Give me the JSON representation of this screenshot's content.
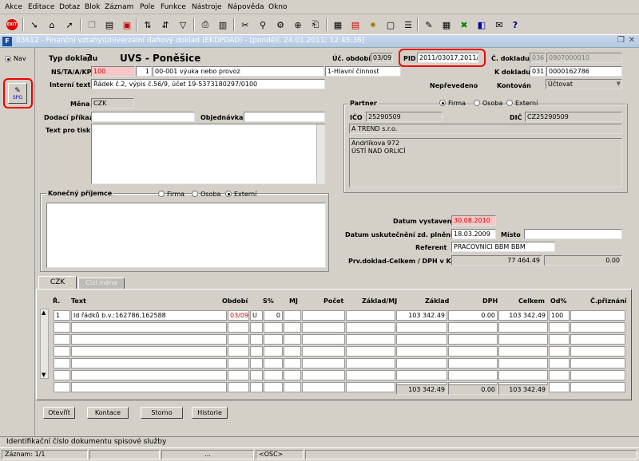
{
  "menu": [
    "Akce",
    "Editace",
    "Dotaz",
    "Blok",
    "Záznam",
    "Pole",
    "Funkce",
    "Nástroje",
    "Nápověda",
    "Okno"
  ],
  "window_title": "03612 - Finanční vztahy\\Univerzální daňový doklad (EKDPDAD) - [pondělí, 24.01.2011; 12:45:36]",
  "left": {
    "nav": "Nav",
    "spg": "SPG"
  },
  "header": {
    "typ_label": "Typ dokladu",
    "typ_value": "7",
    "typ_name": "UVS - Poněšice",
    "uc_obdobi_label": "Úč. období",
    "uc_obdobi": "03/09",
    "pid_label": "PID",
    "pid": "2011/03017,2011/0",
    "c_dokladu_label": "Č. dokladu",
    "c_dokladu_a": "036",
    "c_dokladu_b": "0907000010",
    "ns_label": "NS/TA/A/KP",
    "ns": "100",
    "ta": "1",
    "a": "00-001 výuka nebo provoz",
    "kp": "1-Hlavní činnost",
    "k_dokladu_label": "K dokladu",
    "k_dokladu_a": "031",
    "k_dokladu_b": "0000162786",
    "interni_label": "Interní text",
    "interni": "Řádek č.2,  výpis č.56/9, účet 19-5373180297/0100",
    "neprevedeno": "Nepřevedeno",
    "kontovan_label": "Kontován",
    "kontovan": "Účtovat"
  },
  "form": {
    "mena_label": "Měna",
    "mena": "CZK",
    "dodaci_label": "Dodací příkaz",
    "objednavka_label": "Objednávka",
    "text_tisk_label": "Text pro tisk",
    "konecny_label": "Konečný příjemce",
    "r_firma": "Firma",
    "r_osoba": "Osoba",
    "r_externi": "Externí"
  },
  "partner": {
    "label": "Partner",
    "r_firma": "Firma",
    "r_osoba": "Osoba",
    "r_externi": "Externí",
    "ico_label": "IČO",
    "ico": "25290509",
    "dic_label": "DIČ",
    "dic": "CZ25290509",
    "name": "A TREND s.r.o.",
    "addr1": "Andrlíkova 972",
    "addr2": "ÚSTÍ NAD ORLICÍ"
  },
  "dates": {
    "vystaveni_label": "Datum vystavení",
    "vystaveni": "30.08.2010",
    "zd_label": "Datum uskutečnění zd. plnění",
    "zd": "18.03.2009",
    "misto_label": "Místo",
    "referent_label": "Referent",
    "referent": "PRACOVNÍCI BBM BBM",
    "prv_label": "Prv.doklad-Celkem / DPH v Kč",
    "prv_celkem": "77 464.49",
    "prv_dph": "0.00"
  },
  "tabs": [
    "CZK",
    "Cizí měna"
  ],
  "table": {
    "headers": [
      "Ř.",
      "Text",
      "Období",
      "S%",
      "MJ",
      "Počet",
      "Základ/MJ",
      "Základ",
      "DPH",
      "Celkem",
      "Od%",
      "Č.přiznání"
    ],
    "row1": {
      "r": "1",
      "text": "ld řádků b.v.:162786,162588",
      "obdobi": "03/09",
      "s": "U",
      "sp": "0",
      "zaklad": "103 342.49",
      "dph": "0.00",
      "celkem": "103 342.49",
      "od": "100"
    },
    "totals": {
      "zaklad": "103 342.49",
      "dph": "0.00",
      "celkem": "103 342.49"
    }
  },
  "buttons": {
    "otevrit": "Otevřít",
    "kontace": "Kontace",
    "storno": "Storno",
    "historie": "Historie"
  },
  "status": {
    "hint": "Identifikační číslo dokumentu spisové služby",
    "zaznam": "Záznam: 1/1",
    "dots": "...",
    "osc": "<OSC>"
  }
}
